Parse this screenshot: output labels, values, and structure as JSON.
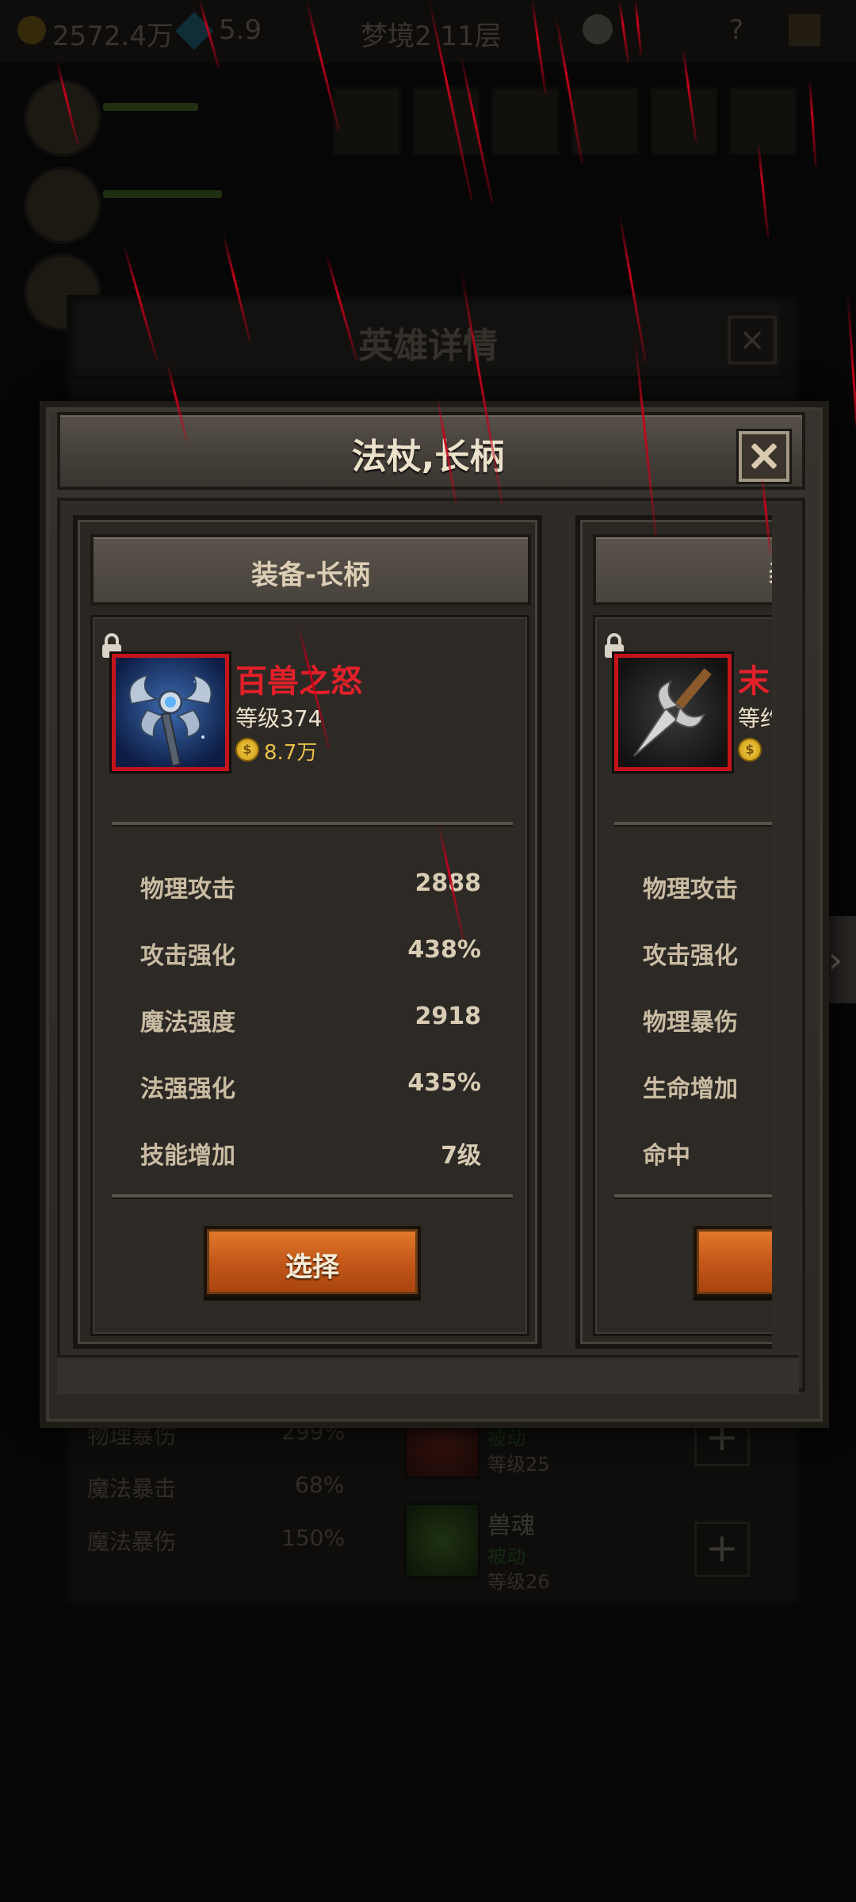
{
  "background": {
    "currency_gold": "2572.4万",
    "currency_gem": "5.9",
    "stage_label": "梦境2 11层",
    "panel_title": "英雄详情",
    "stats": [
      {
        "name": "物理暴伤",
        "value": "299%"
      },
      {
        "name": "魔法暴击",
        "value": "68%"
      },
      {
        "name": "魔法暴伤",
        "value": "150%"
      }
    ],
    "skills": [
      {
        "name": "",
        "type": "被动",
        "level": "等级25"
      },
      {
        "name": "兽魂",
        "type": "被动",
        "level": "等级26"
      }
    ]
  },
  "modal": {
    "title": "法杖,长柄"
  },
  "cards": [
    {
      "header": "装备-长柄",
      "item_name": "百兽之怒",
      "level": "等级374",
      "price": "8.7万",
      "stats": [
        {
          "name": "物理攻击",
          "value": "2888"
        },
        {
          "name": "攻击强化",
          "value": "438%"
        },
        {
          "name": "魔法强度",
          "value": "2918"
        },
        {
          "name": "法强强化",
          "value": "435%"
        },
        {
          "name": "技能增加",
          "value": "7级"
        }
      ],
      "button_label": "选择"
    },
    {
      "header": "装",
      "item_name": "末",
      "level": "等约",
      "price": "",
      "stats": [
        {
          "name": "物理攻击",
          "value": ""
        },
        {
          "name": "攻击强化",
          "value": ""
        },
        {
          "name": "物理暴伤",
          "value": ""
        },
        {
          "name": "生命增加",
          "value": ""
        },
        {
          "name": "命中",
          "value": ""
        }
      ],
      "button_label": ""
    }
  ]
}
